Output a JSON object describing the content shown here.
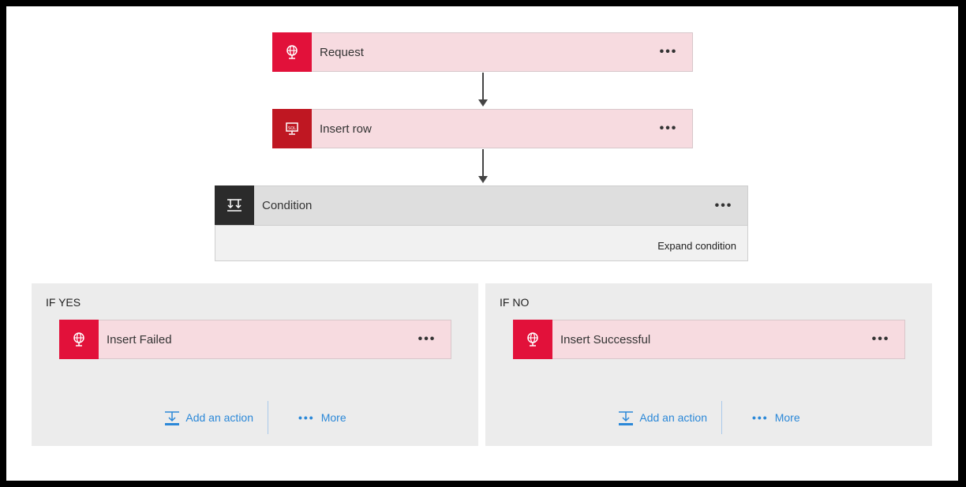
{
  "flow": {
    "request": {
      "label": "Request",
      "menu": "•••"
    },
    "insert_row": {
      "label": "Insert row",
      "menu": "•••"
    },
    "condition": {
      "label": "Condition",
      "menu": "•••",
      "expand_label": "Expand condition"
    }
  },
  "branches": {
    "yes": {
      "title": "IF YES",
      "card": {
        "label": "Insert Failed",
        "menu": "•••"
      },
      "add_action": "Add an action",
      "more_dots": "•••",
      "more": "More"
    },
    "no": {
      "title": "IF NO",
      "card": {
        "label": "Insert Successful",
        "menu": "•••"
      },
      "add_action": "Add an action",
      "more_dots": "•••",
      "more": "More"
    }
  },
  "colors": {
    "request_red": "#e2113a",
    "sql_red": "#bf1722",
    "condition_black": "#2b2b2b",
    "card_pink": "#f7dbe0",
    "link_blue": "#2b88d8"
  },
  "icons": {
    "request": "globe-icon",
    "insert_row": "sql-server-icon",
    "condition": "condition-icon",
    "add_action": "add-action-icon"
  }
}
